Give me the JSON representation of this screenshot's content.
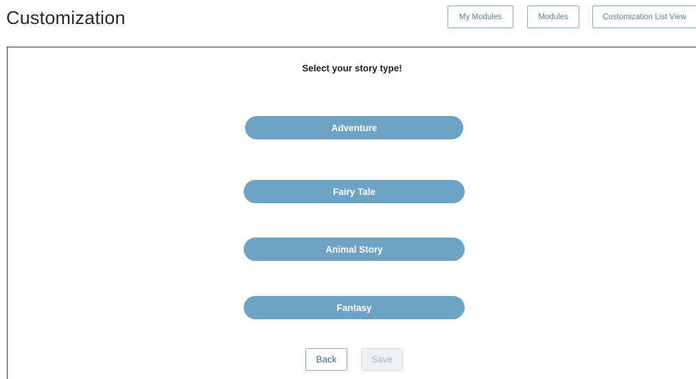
{
  "header": {
    "title": "Customization",
    "buttons": {
      "my_modules": "My Modules",
      "modules": "Modules",
      "customization_list_view": "Customization List View"
    }
  },
  "main": {
    "prompt": "Select your story type!",
    "story_types": [
      "Adventure",
      "Fairy Tale",
      "Animal Story",
      "Fantasy"
    ],
    "actions": {
      "back": "Back",
      "save": "Save"
    },
    "colors": {
      "story_button_bg": "#6fa3c4",
      "outline_accent": "#7fa6bf"
    }
  }
}
